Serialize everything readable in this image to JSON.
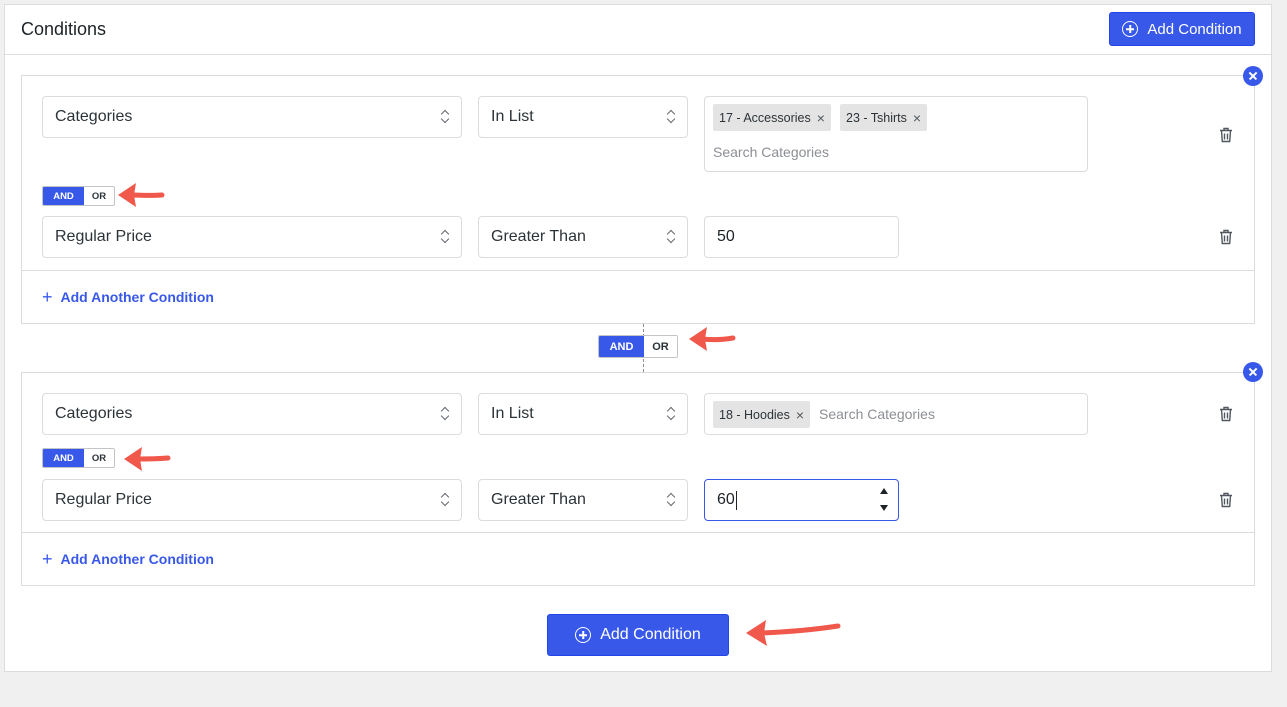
{
  "panel": {
    "title": "Conditions",
    "add_condition_label": "Add Condition"
  },
  "groups": [
    {
      "rows": [
        {
          "field": "Categories",
          "operator": "In List",
          "tags": [
            "17 - Accessories",
            "23 - Tshirts"
          ],
          "search_placeholder": "Search Categories"
        },
        {
          "field": "Regular Price",
          "operator": "Greater Than",
          "value": "50"
        }
      ],
      "toggle": {
        "and_label": "AND",
        "or_label": "OR",
        "selected": "AND"
      },
      "add_another_label": "Add Another Condition"
    },
    {
      "rows": [
        {
          "field": "Categories",
          "operator": "In List",
          "tags": [
            "18 - Hoodies"
          ],
          "search_placeholder": "Search Categories"
        },
        {
          "field": "Regular Price",
          "operator": "Greater Than",
          "value": "60"
        }
      ],
      "toggle": {
        "and_label": "AND",
        "or_label": "OR",
        "selected": "AND"
      },
      "add_another_label": "Add Another Condition"
    }
  ],
  "group_connector": {
    "and_label": "AND",
    "or_label": "OR",
    "selected": "AND"
  },
  "bottom": {
    "add_condition_label": "Add Condition"
  },
  "colors": {
    "accent": "#3858e9",
    "annotation_arrow": "#f0584b",
    "border": "#dcdcde"
  }
}
